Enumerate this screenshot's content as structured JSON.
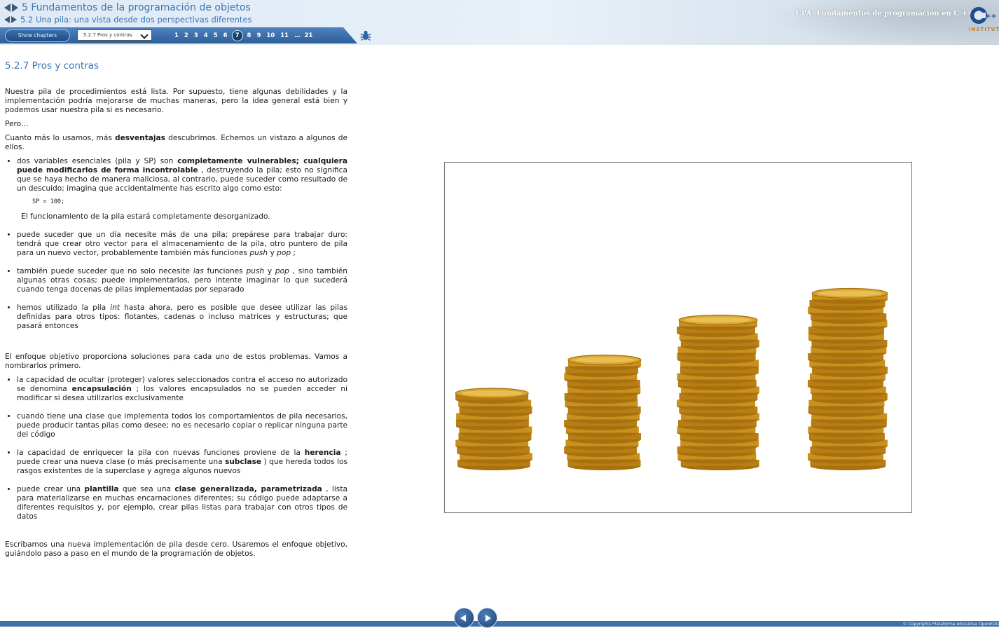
{
  "header": {
    "chapter_title": "5 Fundamentos de la programación de objetos",
    "section_title": "5.2 Una pila: una vista desde dos perspectivas diferentes",
    "show_chapters_label": "Show chapters",
    "section_select_value": "5.2.7 Pros y contras",
    "pages": [
      "1",
      "2",
      "3",
      "4",
      "5",
      "6",
      "7",
      "8",
      "9",
      "10",
      "11",
      "…",
      "21"
    ],
    "active_page": "7",
    "course_title": "CPA: Fundamentos de programación en C ++",
    "logo_text": "INSTITUTE",
    "logo_mark": "C++"
  },
  "content": {
    "heading": "5.2.7 Pros y contras",
    "intro": "Nuestra pila de procedimientos está lista. Por supuesto, tiene algunas debilidades y la implementación podría mejorarse de muchas maneras, pero la idea general está bien y podemos usar nuestra pila si es necesario.",
    "pero": "Pero…",
    "p2_a": "Cuanto más lo usamos, más ",
    "p2_b": "desventajas",
    "p2_c": " descubrimos. Echemos un vistazo a algunos de ellos.",
    "d1_a": "dos variables esenciales (pila y SP) son ",
    "d1_b": "completamente vulnerables; cualquiera puede modificarlos de forma incontrolable",
    "d1_c": " , destruyendo la pila; esto no significa que se haya hecho de manera maliciosa, al contrario, puede suceder como resultado de un descuido; imagina que accidentalmente has escrito algo como esto:",
    "code": "SP = 100;",
    "d1_after": "El funcionamiento de la pila estará completamente desorganizado.",
    "d2_a": "puede suceder que un día necesite más de una pila; prepárese para trabajar duro: tendrá que crear otro vector para el almacenamiento de la pila, otro puntero de pila para un nuevo vector, probablemente también más funciones ",
    "d2_push": "push",
    "d2_y": " y ",
    "d2_pop": "pop",
    "d2_end": " ;",
    "d3_a": "también puede suceder que no solo necesite ",
    "d3_las": "las",
    "d3_b": " funciones ",
    "d3_push": "push",
    "d3_y": " y ",
    "d3_pop": "pop",
    "d3_c": " , sino también algunas otras cosas; puede implementarlos, pero intente imaginar lo que sucederá cuando tenga docenas de pilas implementadas por separado",
    "d4_a": "hemos utilizado la pila ",
    "d4_int": "int",
    "d4_b": " hasta ahora, pero es posible que desee utilizar las pilas definidas para otros tipos: flotantes, cadenas o incluso matrices y estructuras; que pasará entonces",
    "obj_intro": "El enfoque objetivo proporciona soluciones para cada uno de estos problemas. Vamos a nombrarlos primero.",
    "s1_a": "la capacidad de ocultar (proteger) valores seleccionados contra el acceso no autorizado se denomina ",
    "s1_b": "encapsulación",
    "s1_c": " ; los valores encapsulados no se pueden acceder ni modificar si desea utilizarlos exclusivamente",
    "s2": "cuando tiene una clase que implementa todos los comportamientos de pila necesarios, puede producir tantas pilas como desee; no es necesario copiar o replicar ninguna parte del código",
    "s3_a": "la capacidad de enriquecer la pila con nuevas funciones proviene de la ",
    "s3_b": "herencia",
    "s3_c": " ; puede crear una nueva clase (o más precisamente una ",
    "s3_d": "subclase",
    "s3_e": " ) que hereda todos los rasgos existentes de la superclase y agrega algunos nuevos",
    "s4_a": "puede crear una ",
    "s4_b": "plantilla",
    "s4_c": " que sea una ",
    "s4_d": "clase generalizada, parametrizada",
    "s4_e": " , lista para materializarse en muchas encarnaciones diferentes; su código puede adaptarse a diferentes requisitos y, por ejemplo, crear pilas listas para trabajar con otros tipos de datos",
    "closing": "Escribamos una nueva implementación de pila desde cero. Usaremos el enfoque objetivo, guiándolo paso a paso en el mundo de la programación de objetos."
  },
  "figure": {
    "icon": "stacked-gold-coins-image",
    "coin_stacks": [
      11,
      16,
      22,
      26
    ],
    "coin_color": "#d9a630"
  },
  "footer": {
    "copyright": "© Copyrights Plataforma educativa OpenEDG"
  }
}
